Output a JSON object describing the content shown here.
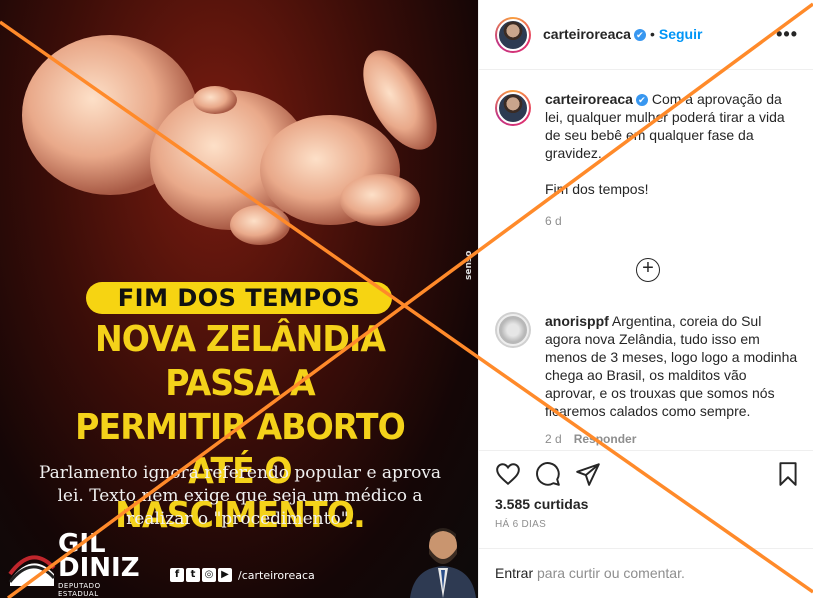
{
  "post": {
    "label_pill": "FIM DOS TEMPOS",
    "headline_lines": [
      "NOVA ZELÂNDIA PASSA A",
      "PERMITIR ABORTO ATÉ O",
      "NASCIMENTO."
    ],
    "subtitle": "Parlamento ignora referendo popular e aprova lei. Texto nem exige que seja um médico a realizar o \"procedimento\".",
    "logo_name_line1": "GIL",
    "logo_name_line2": "DINIZ",
    "logo_sub": "DEPUTADO ESTADUAL",
    "social_icons": [
      "f",
      "t",
      "◎",
      "▶"
    ],
    "social_handle": "/carteiroreaca",
    "side_tag": "senso"
  },
  "header": {
    "username": "carteiroreaca",
    "verified_icon": "✔",
    "separator": "•",
    "follow_label": "Seguir",
    "more_label": "•••"
  },
  "caption": {
    "username": "carteiroreaca",
    "text_part1": "Com a aprovação da lei, qualquer mulher poderá tirar a vida de seu bebê em qualquer fase da gravidez.",
    "text_part2": "Fim dos tempos!",
    "time": "6 d"
  },
  "load_more_label": "+",
  "comments": [
    {
      "username": "anorisppf",
      "text": "Argentina, coreia do Sul agora nova Zelândia, tudo isso em menos de 3 meses, logo logo a modinha chega ao Brasil, os malditos vão aprovar, e os trouxas que somos nós ficaremos calados como sempre.",
      "time": "2 d",
      "reply_label": "Responder"
    }
  ],
  "actions": {
    "likes": "3.585 curtidas",
    "timestamp": "HÁ 6 DIAS"
  },
  "add_comment": {
    "login_link": "Entrar",
    "prompt": " para curtir ou comentar."
  },
  "colors": {
    "overlay_x": "#ff8a2a",
    "accent_yellow": "#f4d21a",
    "follow_blue": "#0095f6"
  }
}
